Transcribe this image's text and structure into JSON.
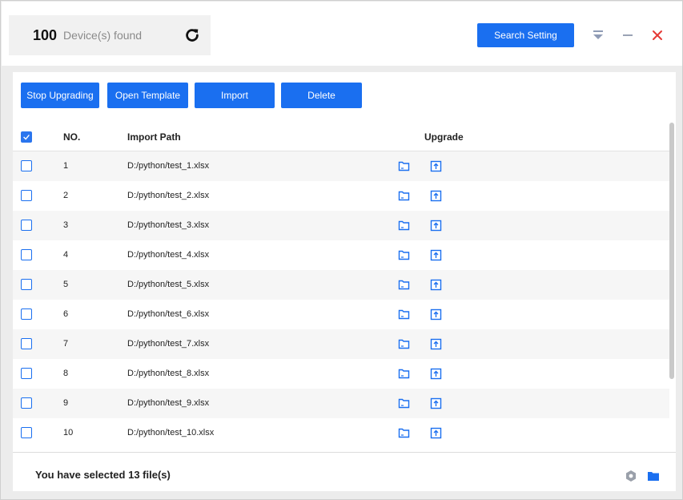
{
  "header": {
    "device_count": "100",
    "device_label": "Device(s) found",
    "search_button": "Search Setting"
  },
  "toolbar": {
    "stop_upgrading": "Stop Upgrading",
    "open_template": "Open Template",
    "import": "Import",
    "delete": "Delete"
  },
  "table": {
    "columns": {
      "no": "NO.",
      "import_path": "Import Path",
      "upgrade": "Upgrade"
    },
    "header_checked": true,
    "rows": [
      {
        "no": "1",
        "path": "D:/python/test_1.xlsx",
        "checked": false
      },
      {
        "no": "2",
        "path": "D:/python/test_2.xlsx",
        "checked": false
      },
      {
        "no": "3",
        "path": "D:/python/test_3.xlsx",
        "checked": false
      },
      {
        "no": "4",
        "path": "D:/python/test_4.xlsx",
        "checked": false
      },
      {
        "no": "5",
        "path": "D:/python/test_5.xlsx",
        "checked": false
      },
      {
        "no": "6",
        "path": "D:/python/test_6.xlsx",
        "checked": false
      },
      {
        "no": "7",
        "path": "D:/python/test_7.xlsx",
        "checked": false
      },
      {
        "no": "8",
        "path": "D:/python/test_8.xlsx",
        "checked": false
      },
      {
        "no": "9",
        "path": "D:/python/test_9.xlsx",
        "checked": false
      },
      {
        "no": "10",
        "path": "D:/python/test_10.xlsx",
        "checked": false
      }
    ]
  },
  "footer": {
    "status": "You have selected 13 file(s)"
  },
  "icons": {
    "refresh": "refresh-icon",
    "menu": "dropdown-menu-icon",
    "minimize": "minimize-icon",
    "close": "close-icon",
    "row_folder": "folder-open-icon",
    "row_upgrade": "upload-icon",
    "footer_settings": "hexagon-settings-icon",
    "footer_folder": "folder-icon"
  },
  "colors": {
    "accent": "#1a6ff0",
    "close": "#e53935",
    "background": "#ececec"
  }
}
